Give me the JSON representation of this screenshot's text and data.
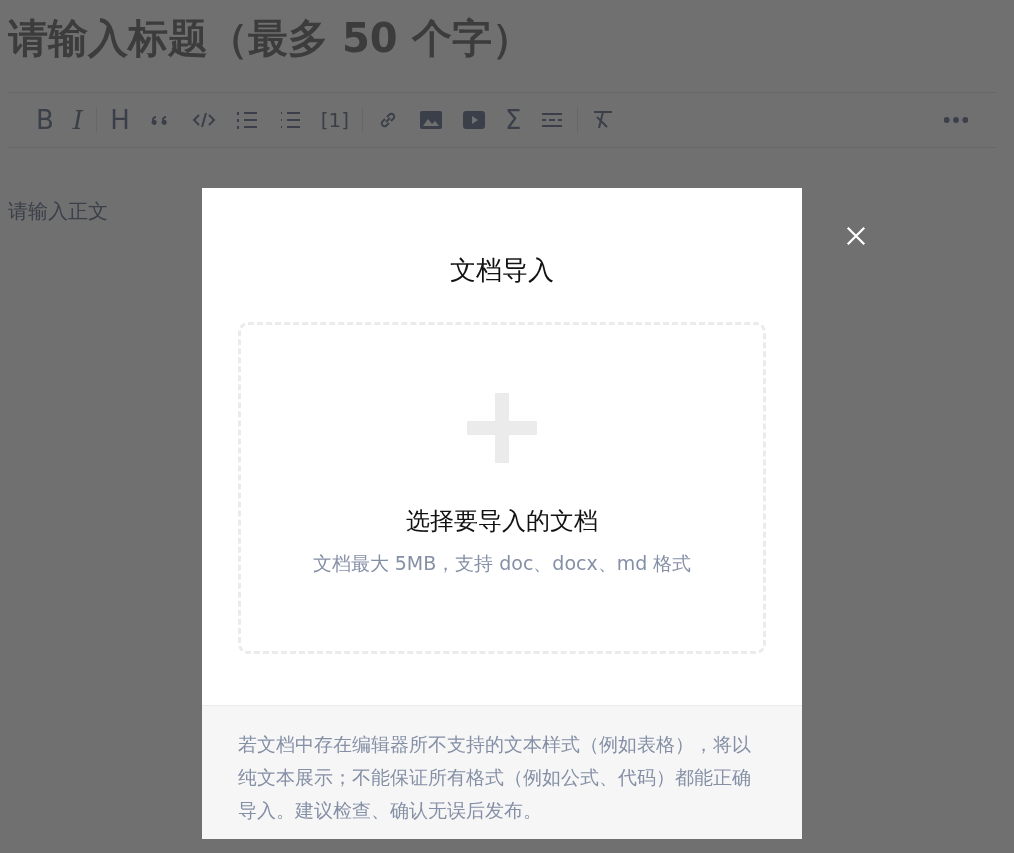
{
  "editor": {
    "title_placeholder": "请输入标题（最多 50 个字）",
    "body_placeholder": "请输入正文",
    "toolbar": [
      "B",
      "I",
      "H",
      "[1]",
      "Σ"
    ]
  },
  "dialog": {
    "title": "文档导入",
    "upload": {
      "label": "选择要导入的文档",
      "hint": "文档最大 5MB，支持 doc、docx、md 格式"
    },
    "note": "若文档中存在编辑器所不支持的文本样式（例如表格），将以纯文本展示；不能保证所有格式（例如公式、代码）都能正确导入。建议检查、确认无误后发布。"
  }
}
